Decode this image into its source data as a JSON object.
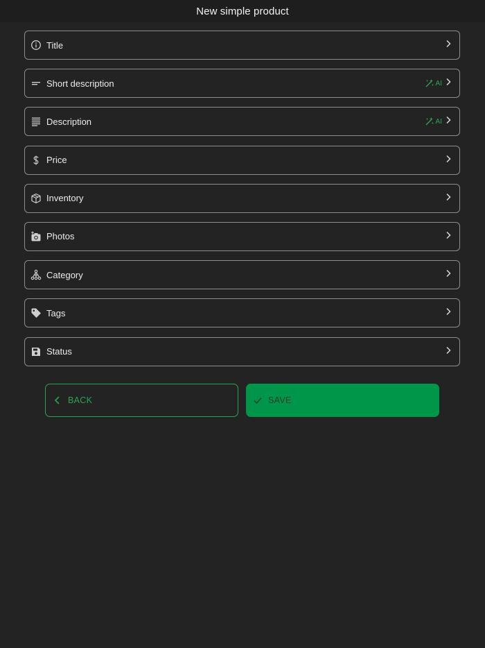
{
  "header": {
    "title": "New simple product"
  },
  "fields": [
    {
      "label": "Title",
      "icon": "info-icon",
      "ai": false
    },
    {
      "label": "Short description",
      "icon": "short-text-icon",
      "ai": true,
      "ai_label": "AI"
    },
    {
      "label": "Description",
      "icon": "long-text-icon",
      "ai": true,
      "ai_label": "AI"
    },
    {
      "label": "Price",
      "icon": "dollar-icon",
      "ai": false
    },
    {
      "label": "Inventory",
      "icon": "box-icon",
      "ai": false
    },
    {
      "label": "Photos",
      "icon": "camera-icon",
      "ai": false
    },
    {
      "label": "Category",
      "icon": "category-tree-icon",
      "ai": false
    },
    {
      "label": "Tags",
      "icon": "tag-icon",
      "ai": false
    },
    {
      "label": "Status",
      "icon": "save-icon",
      "ai": false
    }
  ],
  "actions": {
    "back_label": "BACK",
    "save_label": "SAVE"
  },
  "colors": {
    "background": "#232323",
    "accent": "#00964a",
    "ai_green": "#2fa35a"
  }
}
